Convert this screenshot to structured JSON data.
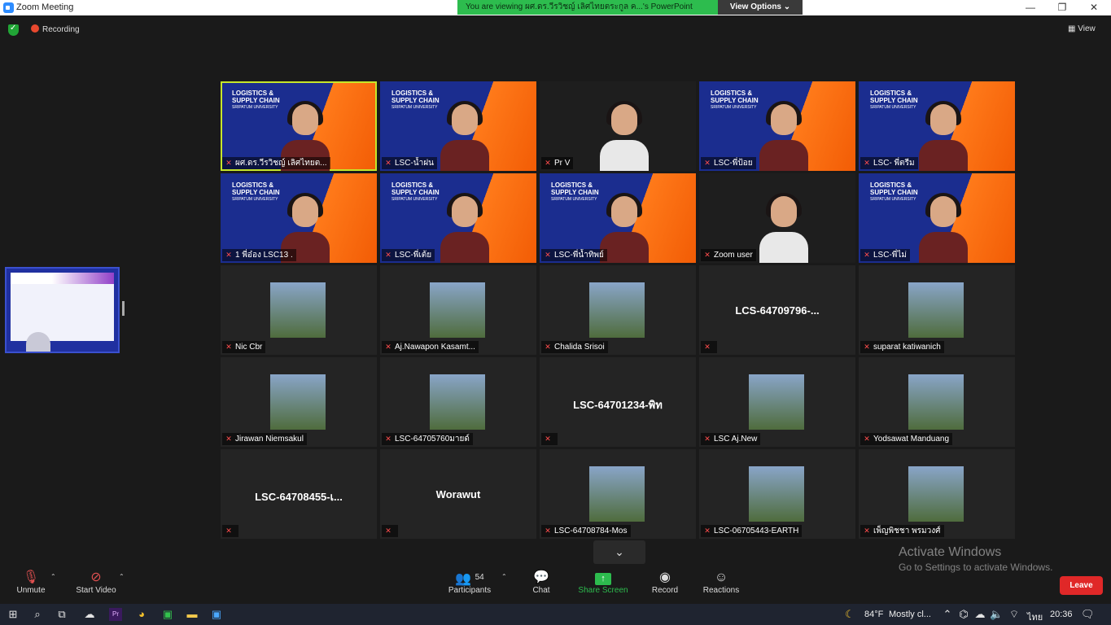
{
  "window": {
    "title": "Zoom Meeting",
    "minimize": "—",
    "restore": "❐",
    "close": "✕"
  },
  "banner": {
    "text": "You are viewing ผศ.ดร.วีรวิชญ์ เลิศไทยตระกูล ค...'s PowerPoint",
    "view_options": "View Options ⌄"
  },
  "status": {
    "recording": "Recording",
    "view": "View"
  },
  "colors": {
    "accent_green": "#2dbc4e",
    "active_border": "#c6e62a",
    "leave_red": "#e02828",
    "mic_off_red": "#ff4d4d"
  },
  "tiles": [
    {
      "name": "ผศ.ดร.วีรวิชญ์ เลิศไทยต...",
      "style": "active"
    },
    {
      "name": "LSC-น้ำฝน",
      "style": "brand"
    },
    {
      "name": "Pr V",
      "style": "dark"
    },
    {
      "name": "LSC-พี่ป้อย",
      "style": "brand"
    },
    {
      "name": "LSC- พี่ตรีม",
      "style": "brand"
    },
    {
      "name": "1 พี่อ๋อง LSC13 .",
      "style": "brand"
    },
    {
      "name": "LSC-พี่เต้ย",
      "style": "brand"
    },
    {
      "name": "LSC-พี่น้ำทิพย์",
      "style": "brand"
    },
    {
      "name": "Zoom user",
      "style": "dark"
    },
    {
      "name": "LSC-พี่ไม่",
      "style": "brand"
    },
    {
      "name": "Nic Cbr",
      "style": "thumb"
    },
    {
      "name": "Aj.Nawapon Kasamt...",
      "style": "thumb"
    },
    {
      "name": "Chalida Srisoi",
      "style": "thumb"
    },
    {
      "name": "",
      "big": "LCS-64709796-...",
      "style": "text"
    },
    {
      "name": "suparat katiwanich",
      "style": "thumb"
    },
    {
      "name": "Jirawan Niemsakul",
      "style": "thumb"
    },
    {
      "name": "LSC-64705760มายด์",
      "style": "thumb"
    },
    {
      "name": "",
      "big": "LSC-64701234-พิท",
      "style": "text"
    },
    {
      "name": "LSC Aj.New",
      "style": "thumb"
    },
    {
      "name": "Yodsawat Manduang",
      "style": "thumb"
    },
    {
      "name": "",
      "big": "LSC-64708455-เ...",
      "style": "text"
    },
    {
      "name": "",
      "big": "Worawut",
      "style": "text"
    },
    {
      "name": "LSC-64708784-Mos",
      "style": "thumb"
    },
    {
      "name": "LSC-06705443-EARTH",
      "style": "thumb"
    },
    {
      "name": "เพ็ญพิชชา พรมวงศ์",
      "style": "thumb"
    }
  ],
  "brand_text": {
    "line1": "LOGISTICS &",
    "line2": "SUPPLY CHAIN",
    "line3": "SRIPATUM UNIVERSITY"
  },
  "toolbar": {
    "unmute": "Unmute",
    "start_video": "Start Video",
    "participants": "Participants",
    "participants_count": "54",
    "chat": "Chat",
    "share_screen": "Share Screen",
    "record": "Record",
    "reactions": "Reactions",
    "leave": "Leave"
  },
  "watermark": {
    "line1": "Activate Windows",
    "line2": "Go to Settings to activate Windows."
  },
  "taskbar": {
    "weather_temp": "84°F",
    "weather_text": "Mostly cl...",
    "lang": "ไทย",
    "time": "20:36"
  }
}
